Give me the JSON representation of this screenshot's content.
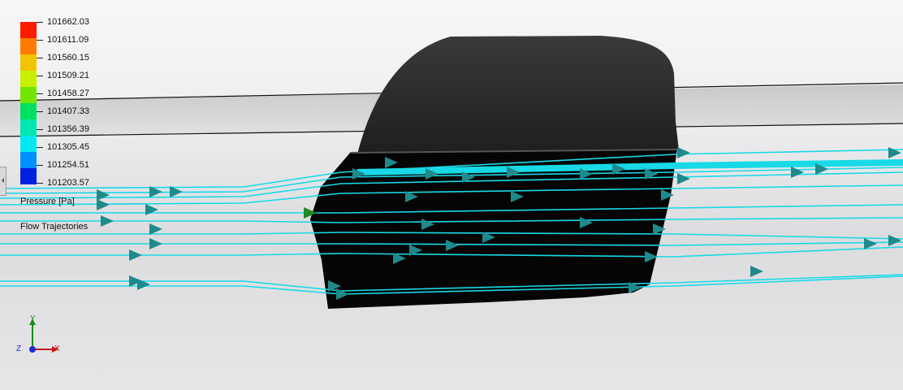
{
  "legend": {
    "values": [
      "101662.03",
      "101611.09",
      "101560.15",
      "101509.21",
      "101458.27",
      "101407.33",
      "101356.39",
      "101305.45",
      "101254.51",
      "101203.57"
    ],
    "colors": [
      "#ff1a00",
      "#ff7a00",
      "#f2c300",
      "#c8f000",
      "#73e600",
      "#00e060",
      "#00e8b0",
      "#00e8f0",
      "#0090ff",
      "#0020e0"
    ],
    "quantity_label": "Pressure [Pa]",
    "plot_label": "Flow Trajectories"
  },
  "triad": {
    "x": "X",
    "y": "Y",
    "z": "Z"
  },
  "colors": {
    "trajectory": "#18d9e6",
    "arrow": "#1e8a8c",
    "body": "#2b2b2b",
    "panel": "#0a0a0a"
  }
}
